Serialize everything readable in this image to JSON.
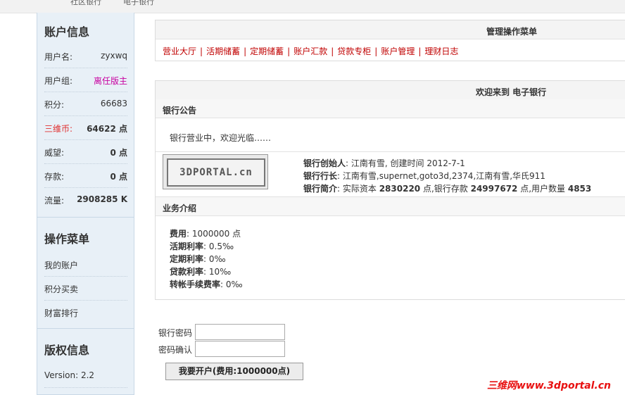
{
  "topbar": {
    "link1": "社区银行",
    "link2": "电子银行"
  },
  "sidebar": {
    "account_title": "账户信息",
    "rows": [
      {
        "label": "用户名:",
        "value": "zyxwq"
      },
      {
        "label": "用户组:",
        "value": "离任版主"
      },
      {
        "label": "积分:",
        "value": "66683"
      },
      {
        "label": "三维币:",
        "value": "64622 点"
      },
      {
        "label": "威望:",
        "value": "0 点"
      },
      {
        "label": "存款:",
        "value": "0 点"
      },
      {
        "label": "流量:",
        "value": "2908285 K"
      }
    ],
    "menu_title": "操作菜单",
    "menu": [
      "我的账户",
      "积分买卖",
      "财富排行"
    ],
    "copyright_title": "版权信息",
    "version": "Version: 2.2"
  },
  "main": {
    "menu_panel_title": "管理操作菜单",
    "nav": [
      "营业大厅",
      "活期储蓄",
      "定期储蓄",
      "账户汇款",
      "贷款专柜",
      "账户管理",
      "理财日志"
    ],
    "welcome_title": "欢迎来到 电子银行",
    "notice_title": "银行公告",
    "notice_text": "银行营业中，欢迎光临……",
    "logo_text": "3DPORTAL.cn",
    "founder_label": "银行创始人",
    "founder_value": ": 江南有雪, 创建时间 2012-7-1",
    "president_label": "银行行长",
    "president_value": ": 江南有雪,supernet,goto3d,2374,江南有雪,华氏911",
    "intro_label": "银行简介",
    "intro_pre": ": 实际资本 ",
    "intro_capital": "2830220",
    "intro_mid": " 点,银行存款 ",
    "intro_deposit": "24997672",
    "intro_mid2": " 点,用户数量 ",
    "intro_users": "4853",
    "biz_title": "业务介绍",
    "biz": [
      {
        "label": "费用",
        "value": ": 1000000 点"
      },
      {
        "label": "活期利率",
        "value": ": 0.5‰"
      },
      {
        "label": "定期利率",
        "value": ": 0‰"
      },
      {
        "label": "贷款利率",
        "value": ": 10‰"
      },
      {
        "label": "转帐手续费率",
        "value": ": 0‰"
      }
    ]
  },
  "form": {
    "password_label": "银行密码",
    "confirm_label": "密码确认",
    "submit_label": "我要开户(费用:1000000点)"
  },
  "watermark": "三维网www.3dportal.cn"
}
